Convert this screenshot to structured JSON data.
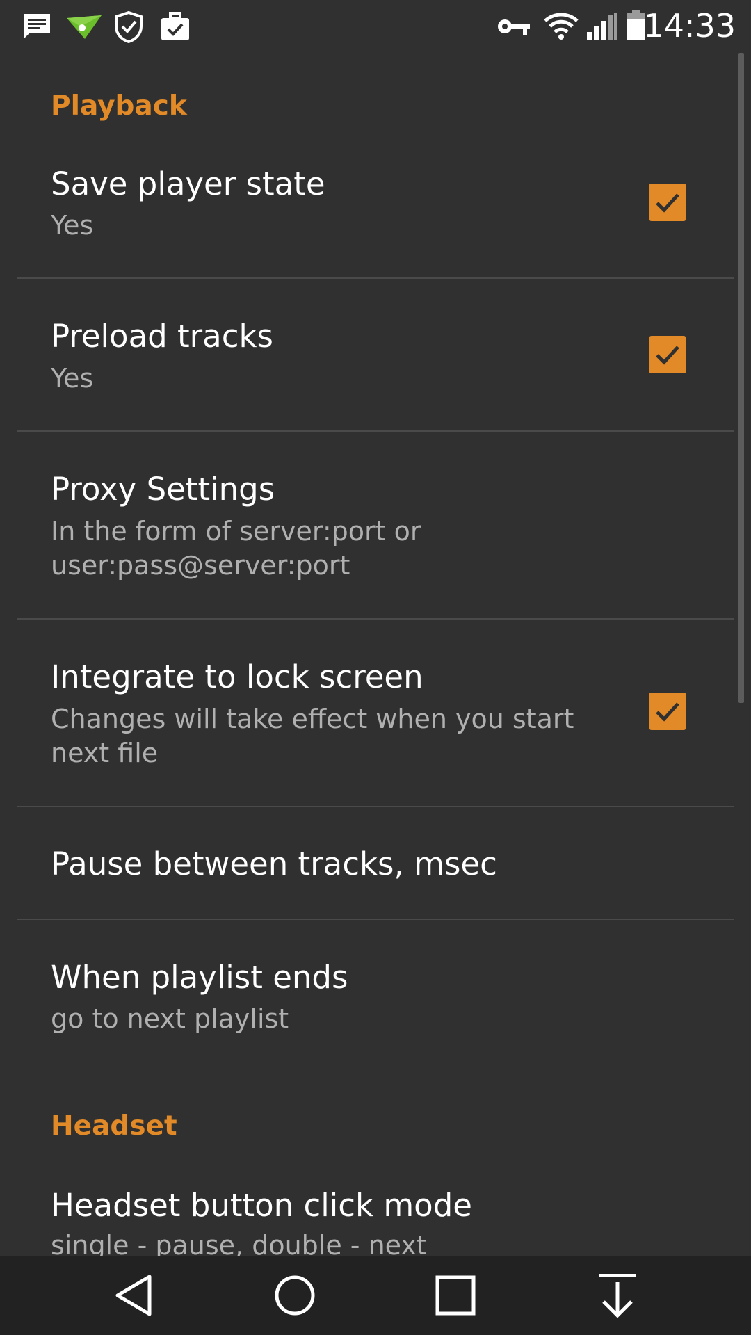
{
  "status_bar": {
    "time": "14:33",
    "left_icons": [
      "message-icon",
      "airdroid-icon",
      "shield-check-icon",
      "briefcase-check-icon"
    ],
    "right_icons": [
      "vpn-key-icon",
      "wifi-icon",
      "signal-icon",
      "battery-icon"
    ]
  },
  "colors": {
    "accent": "#e18a27",
    "background": "#303030",
    "navbar": "#222222",
    "summary_text": "#b0b0b0"
  },
  "sections": [
    {
      "header": "Playback",
      "items": [
        {
          "title": "Save player state",
          "summary": "Yes",
          "checked": true
        },
        {
          "title": "Preload tracks",
          "summary": "Yes",
          "checked": true
        },
        {
          "title": "Proxy Settings",
          "summary": "In the form of server:port or user:pass@server:port"
        },
        {
          "title": "Integrate to lock screen",
          "summary": "Changes will take effect when you start next file",
          "checked": true
        },
        {
          "title": "Pause between tracks, msec"
        },
        {
          "title": "When playlist ends",
          "summary": "go to next playlist"
        }
      ]
    },
    {
      "header": "Headset",
      "items": [
        {
          "title": "Headset button click mode",
          "summary": "single - pause, double - next"
        }
      ]
    }
  ],
  "nav_bar": {
    "buttons": [
      "back-icon",
      "home-icon",
      "recents-icon",
      "notification-pulldown-icon"
    ]
  }
}
